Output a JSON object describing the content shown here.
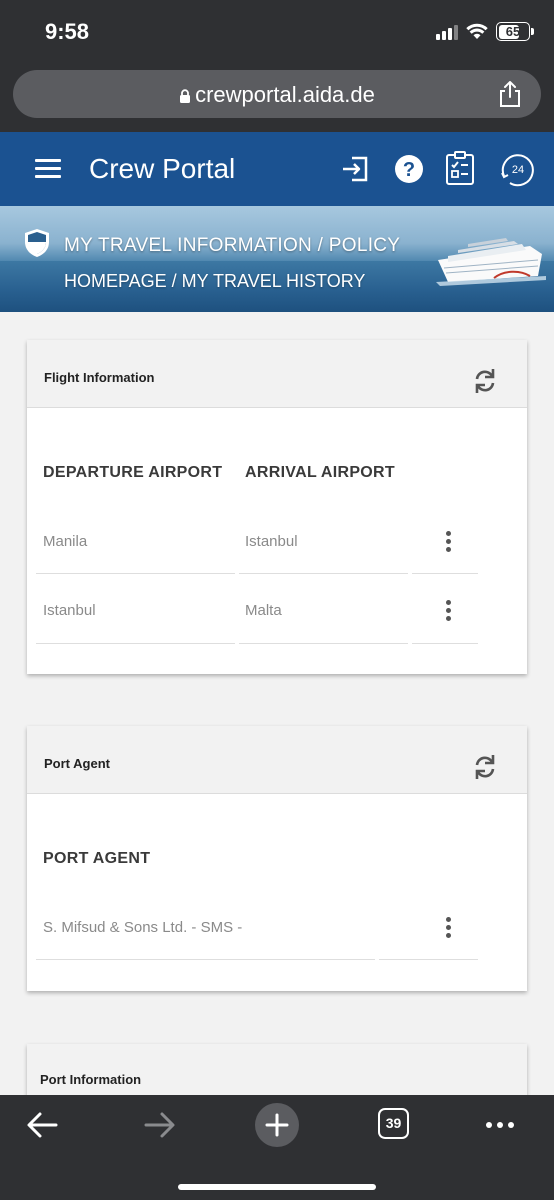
{
  "status_bar": {
    "time": "9:58",
    "battery": "65"
  },
  "browser": {
    "url": "crewportal.aida.de",
    "tab_count": "39"
  },
  "header": {
    "title": "Crew Portal",
    "icons": [
      "menu-icon",
      "logout-icon",
      "help-icon",
      "checklist-icon",
      "support-24-icon"
    ]
  },
  "banner": {
    "title": "MY TRAVEL INFORMATION / POLICY",
    "breadcrumb": "HOMEPAGE / MY TRAVEL HISTORY"
  },
  "flight_info": {
    "title": "Flight Information",
    "columns": [
      "DEPARTURE AIRPORT",
      "ARRIVAL AIRPORT"
    ],
    "rows": [
      {
        "departure": "Manila",
        "arrival": "Istanbul"
      },
      {
        "departure": "Istanbul",
        "arrival": "Malta"
      }
    ]
  },
  "port_agent": {
    "title": "Port Agent",
    "column": "PORT AGENT",
    "rows": [
      {
        "name": "S. Mifsud & Sons Ltd. - SMS -"
      }
    ]
  },
  "port_info": {
    "title": "Port Information"
  },
  "colors": {
    "header_blue": "#1b5291",
    "browser_chrome": "#2f3033",
    "page_bg": "#f2f2f2"
  }
}
